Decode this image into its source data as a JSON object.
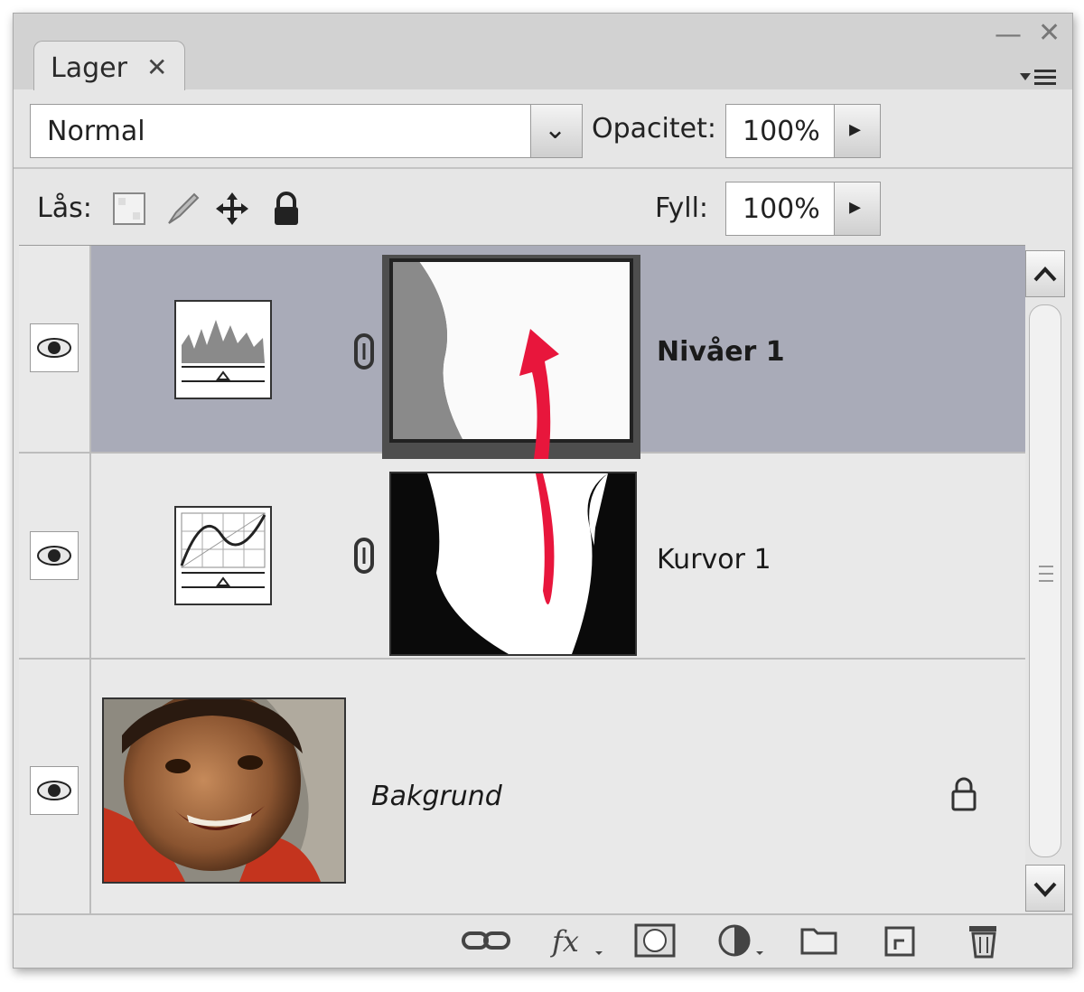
{
  "panel": {
    "tab_label": "Lager",
    "tab_close": "✕",
    "minimize": "—",
    "close": "✕"
  },
  "controls": {
    "blend_mode": "Normal",
    "opacity_label": "Opacitet:",
    "opacity_value": "100%",
    "lock_label": "Lås:",
    "fill_label": "Fyll:",
    "fill_value": "100%"
  },
  "layers": [
    {
      "name": "Nivåer 1",
      "kind": "levels-adjustment",
      "selected": true,
      "visible": true
    },
    {
      "name": "Kurvor 1",
      "kind": "curves-adjustment",
      "selected": false,
      "visible": true
    },
    {
      "name": "Bakgrund",
      "kind": "image",
      "selected": false,
      "visible": true,
      "locked": true
    }
  ],
  "bottom_icons": [
    "link-layers-icon",
    "fx-icon",
    "add-mask-icon",
    "adjustment-layer-icon",
    "new-group-icon",
    "new-layer-icon",
    "trash-icon"
  ],
  "colors": {
    "selected_row": "#a9abb8",
    "arrow": "#e8163c"
  }
}
